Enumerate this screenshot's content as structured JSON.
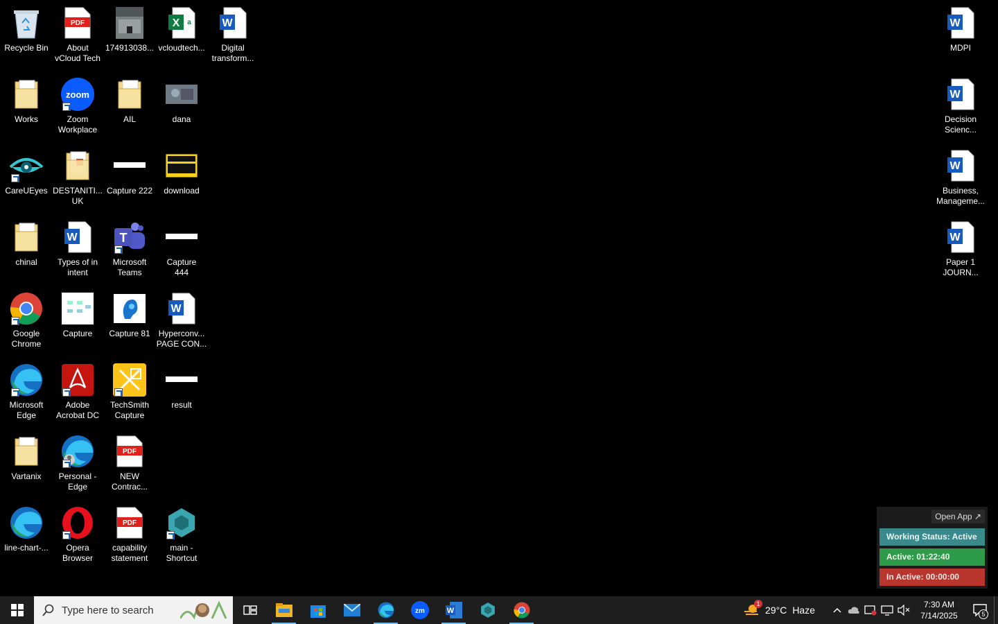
{
  "desktop": {
    "icons": [
      {
        "label": "Recycle Bin",
        "icon": "recycle-bin-icon"
      },
      {
        "label": "About\nvCloud Tech",
        "icon": "pdf-file-icon"
      },
      {
        "label": "174913038...",
        "icon": "image-file-icon"
      },
      {
        "label": "vcloudtech...",
        "icon": "excel-file-icon"
      },
      {
        "label": "Digital\ntransform...",
        "icon": "word-file-icon"
      },
      {
        "label": "Works",
        "icon": "folder-icon"
      },
      {
        "label": "Zoom\nWorkplace",
        "icon": "zoom-app-icon"
      },
      {
        "label": "AIL",
        "icon": "folder-icon"
      },
      {
        "label": "dana",
        "icon": "image-file-icon"
      },
      {
        "label": "CareUEyes",
        "icon": "eye-app-icon"
      },
      {
        "label": "DESTANITI...\nUK",
        "icon": "folder-icon"
      },
      {
        "label": "Capture 222",
        "icon": "image-file-icon"
      },
      {
        "label": "download",
        "icon": "image-file-icon"
      },
      {
        "label": "chinal",
        "icon": "folder-icon"
      },
      {
        "label": "Types of in\nintent",
        "icon": "word-file-icon"
      },
      {
        "label": "Microsoft\nTeams",
        "icon": "teams-app-icon"
      },
      {
        "label": "Capture\n444",
        "icon": "image-file-icon"
      },
      {
        "label": "Google\nChrome",
        "icon": "chrome-app-icon"
      },
      {
        "label": "Capture",
        "icon": "image-file-icon"
      },
      {
        "label": "Capture 81",
        "icon": "image-file-icon"
      },
      {
        "label": "Hyperconv...\nPAGE CON...",
        "icon": "word-file-icon"
      },
      {
        "label": "Microsoft\nEdge",
        "icon": "edge-app-icon"
      },
      {
        "label": "Adobe\nAcrobat DC",
        "icon": "acrobat-app-icon"
      },
      {
        "label": "TechSmith\nCapture",
        "icon": "techsmith-app-icon"
      },
      {
        "label": "result",
        "icon": "image-file-icon"
      },
      {
        "label": "Vartanix",
        "icon": "folder-icon"
      },
      {
        "label": "Personal -\nEdge",
        "icon": "edge-app-icon"
      },
      {
        "label": "NEW\nContrac...",
        "icon": "pdf-file-icon"
      },
      {
        "label": "line-chart-...",
        "icon": "edge-app-icon"
      },
      {
        "label": "Opera\nBrowser",
        "icon": "opera-app-icon"
      },
      {
        "label": "capability\nstatement",
        "icon": "pdf-file-icon"
      },
      {
        "label": "main -\nShortcut",
        "icon": "app-shortcut-icon"
      },
      {
        "label": "MDPI",
        "icon": "word-file-icon"
      },
      {
        "label": "Decision\nScienc...",
        "icon": "word-file-icon"
      },
      {
        "label": "Business,\nManageme...",
        "icon": "word-file-icon"
      },
      {
        "label": "Paper 1\nJOURN...",
        "icon": "word-file-icon"
      }
    ]
  },
  "widget": {
    "open_app": "Open App ↗",
    "working_status": "Working Status: Active",
    "active": "Active: 01:22:40",
    "inactive": "In Active: 00:00:00",
    "colors": {
      "working": "#3a8a8c",
      "active": "#2e9b4a",
      "inactive": "#b8362d"
    }
  },
  "taskbar": {
    "search_placeholder": "Type here to search",
    "apps": [
      {
        "name": "Task View",
        "icon": "task-view-icon"
      },
      {
        "name": "File Explorer",
        "icon": "file-explorer-icon"
      },
      {
        "name": "Microsoft Store",
        "icon": "store-icon"
      },
      {
        "name": "Mail",
        "icon": "mail-icon"
      },
      {
        "name": "Microsoft Edge",
        "icon": "edge-icon"
      },
      {
        "name": "Zoom",
        "icon": "zoom-icon"
      },
      {
        "name": "Word",
        "icon": "word-icon"
      },
      {
        "name": "main",
        "icon": "app-icon"
      },
      {
        "name": "Google Chrome",
        "icon": "chrome-icon"
      }
    ],
    "weather": {
      "badge": "1",
      "temp": "29°C",
      "condition": "Haze"
    },
    "clock": {
      "time": "7:30 AM",
      "date": "7/14/2025"
    },
    "notifications": "5",
    "accent": "#76b9ed"
  }
}
